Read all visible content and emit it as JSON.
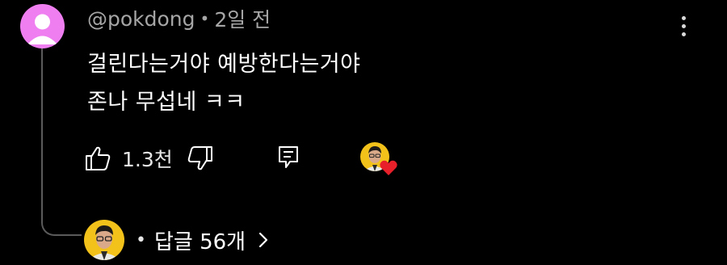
{
  "comment": {
    "handle": "@pokdong",
    "separator": "•",
    "time_ago": "2일 전",
    "lines": [
      "걸린다는거야 예방한다는거야",
      "존나 무섭네 ㅋㅋ"
    ],
    "avatar_color": "#ef7ef0"
  },
  "actions": {
    "like_count": "1.3천",
    "like_icon": "thumb-up-icon",
    "dislike_icon": "thumb-down-icon",
    "reply_icon": "reply-icon",
    "more_icon": "vertical-dots-icon"
  },
  "creator_heart": {
    "heart_color": "#e8202a",
    "icon": "heart-icon"
  },
  "replies": {
    "bullet": "•",
    "label": "답글 56개",
    "chevron_icon": "chevron-right-icon"
  },
  "colors": {
    "background": "#000000",
    "meta_text": "#a6a6a6",
    "thread_line": "#5a5a5a"
  }
}
